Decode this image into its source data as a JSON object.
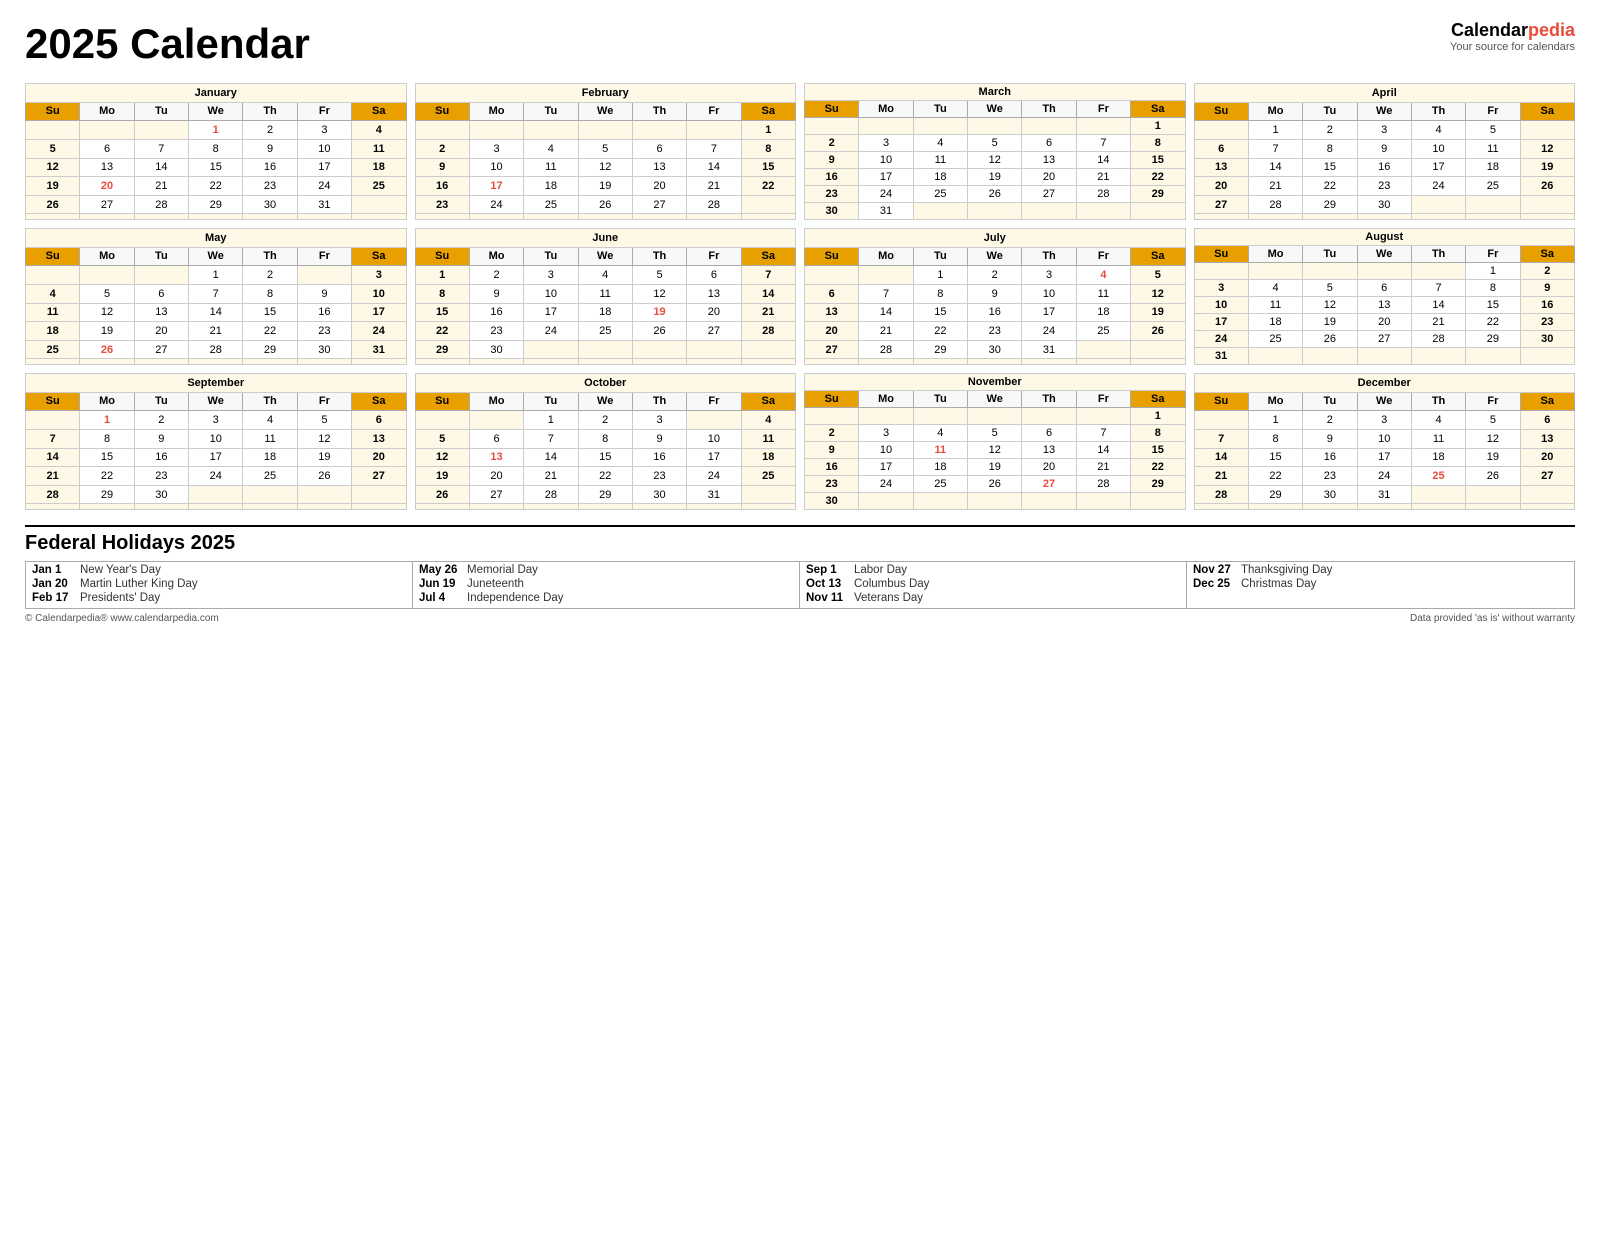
{
  "header": {
    "title": "2025 Calendar",
    "brand_name": "Calendar",
    "brand_em": "pedia",
    "brand_sub": "Your source for calendars"
  },
  "months": [
    {
      "name": "January",
      "days_of_week": [
        "Su",
        "Mo",
        "Tu",
        "We",
        "Th",
        "Fr",
        "Sa"
      ],
      "rows": [
        [
          "",
          "",
          "",
          "1",
          "2",
          "3",
          "4"
        ],
        [
          "5",
          "6",
          "7",
          "8",
          "9",
          "10",
          "11"
        ],
        [
          "12",
          "13",
          "14",
          "15",
          "16",
          "17",
          "18"
        ],
        [
          "19",
          "20",
          "21",
          "22",
          "23",
          "24",
          "25"
        ],
        [
          "26",
          "27",
          "28",
          "29",
          "30",
          "31",
          ""
        ],
        [
          "",
          "",
          "",
          "",
          "",
          "",
          ""
        ]
      ],
      "red": [
        "1",
        "20"
      ],
      "col1_bold": true,
      "col7_bold": true
    },
    {
      "name": "February",
      "days_of_week": [
        "Su",
        "Mo",
        "Tu",
        "We",
        "Th",
        "Fr",
        "Sa"
      ],
      "rows": [
        [
          "",
          "",
          "",
          "",
          "",
          "",
          "1"
        ],
        [
          "2",
          "3",
          "4",
          "5",
          "6",
          "7",
          "8"
        ],
        [
          "9",
          "10",
          "11",
          "12",
          "13",
          "14",
          "15"
        ],
        [
          "16",
          "17",
          "18",
          "19",
          "20",
          "21",
          "22"
        ],
        [
          "23",
          "24",
          "25",
          "26",
          "27",
          "28",
          ""
        ],
        [
          "",
          "",
          "",
          "",
          "",
          "",
          ""
        ]
      ],
      "red": [
        "17"
      ],
      "col1_bold": true,
      "col7_bold": true
    },
    {
      "name": "March",
      "days_of_week": [
        "Su",
        "Mo",
        "Tu",
        "We",
        "Th",
        "Fr",
        "Sa"
      ],
      "rows": [
        [
          "",
          "",
          "",
          "",
          "",
          "",
          "1"
        ],
        [
          "2",
          "3",
          "4",
          "5",
          "6",
          "7",
          "8"
        ],
        [
          "9",
          "10",
          "11",
          "12",
          "13",
          "14",
          "15"
        ],
        [
          "16",
          "17",
          "18",
          "19",
          "20",
          "21",
          "22"
        ],
        [
          "23",
          "24",
          "25",
          "26",
          "27",
          "28",
          "29"
        ],
        [
          "30",
          "31",
          "",
          "",
          "",
          "",
          ""
        ]
      ],
      "red": [],
      "col1_bold": true,
      "col7_bold": true
    },
    {
      "name": "April",
      "days_of_week": [
        "Su",
        "Mo",
        "Tu",
        "We",
        "Th",
        "Fr",
        "Sa"
      ],
      "rows": [
        [
          "",
          "1",
          "2",
          "3",
          "4",
          "5",
          ""
        ],
        [
          "6",
          "7",
          "8",
          "9",
          "10",
          "11",
          "12"
        ],
        [
          "13",
          "14",
          "15",
          "16",
          "17",
          "18",
          "19"
        ],
        [
          "20",
          "21",
          "22",
          "23",
          "24",
          "25",
          "26"
        ],
        [
          "27",
          "28",
          "29",
          "30",
          "",
          "",
          ""
        ],
        [
          "",
          "",
          "",
          "",
          "",
          "",
          ""
        ]
      ],
      "red": [],
      "col1_bold": true,
      "col7_bold": true
    },
    {
      "name": "May",
      "days_of_week": [
        "Su",
        "Mo",
        "Tu",
        "We",
        "Th",
        "Fr",
        "Sa"
      ],
      "rows": [
        [
          "",
          "",
          "",
          "1",
          "2",
          "",
          "3"
        ],
        [
          "4",
          "5",
          "6",
          "7",
          "8",
          "9",
          "10"
        ],
        [
          "11",
          "12",
          "13",
          "14",
          "15",
          "16",
          "17"
        ],
        [
          "18",
          "19",
          "20",
          "21",
          "22",
          "23",
          "24"
        ],
        [
          "25",
          "26",
          "27",
          "28",
          "29",
          "30",
          "31"
        ],
        [
          "",
          "",
          "",
          "",
          "",
          "",
          ""
        ]
      ],
      "red": [
        "26"
      ],
      "col1_bold": true,
      "col7_bold": true
    },
    {
      "name": "June",
      "days_of_week": [
        "Su",
        "Mo",
        "Tu",
        "We",
        "Th",
        "Fr",
        "Sa"
      ],
      "rows": [
        [
          "1",
          "2",
          "3",
          "4",
          "5",
          "6",
          "7"
        ],
        [
          "8",
          "9",
          "10",
          "11",
          "12",
          "13",
          "14"
        ],
        [
          "15",
          "16",
          "17",
          "18",
          "19",
          "20",
          "21"
        ],
        [
          "22",
          "23",
          "24",
          "25",
          "26",
          "27",
          "28"
        ],
        [
          "29",
          "30",
          "",
          "",
          "",
          "",
          ""
        ],
        [
          "",
          "",
          "",
          "",
          "",
          "",
          ""
        ]
      ],
      "red": [
        "19"
      ],
      "col1_bold": true,
      "col7_bold": true
    },
    {
      "name": "July",
      "days_of_week": [
        "Su",
        "Mo",
        "Tu",
        "We",
        "Th",
        "Fr",
        "Sa"
      ],
      "rows": [
        [
          "",
          "",
          "1",
          "2",
          "3",
          "4",
          "5"
        ],
        [
          "6",
          "7",
          "8",
          "9",
          "10",
          "11",
          "12"
        ],
        [
          "13",
          "14",
          "15",
          "16",
          "17",
          "18",
          "19"
        ],
        [
          "20",
          "21",
          "22",
          "23",
          "24",
          "25",
          "26"
        ],
        [
          "27",
          "28",
          "29",
          "30",
          "31",
          "",
          ""
        ],
        [
          "",
          "",
          "",
          "",
          "",
          "",
          ""
        ]
      ],
      "red": [
        "4"
      ],
      "col1_bold": true,
      "col7_bold": true
    },
    {
      "name": "August",
      "days_of_week": [
        "Su",
        "Mo",
        "Tu",
        "We",
        "Th",
        "Fr",
        "Sa"
      ],
      "rows": [
        [
          "",
          "",
          "",
          "",
          "",
          "1",
          "2"
        ],
        [
          "3",
          "4",
          "5",
          "6",
          "7",
          "8",
          "9"
        ],
        [
          "10",
          "11",
          "12",
          "13",
          "14",
          "15",
          "16"
        ],
        [
          "17",
          "18",
          "19",
          "20",
          "21",
          "22",
          "23"
        ],
        [
          "24",
          "25",
          "26",
          "27",
          "28",
          "29",
          "30"
        ],
        [
          "31",
          "",
          "",
          "",
          "",
          "",
          ""
        ]
      ],
      "red": [],
      "col1_bold": true,
      "col7_bold": true
    },
    {
      "name": "September",
      "days_of_week": [
        "Su",
        "Mo",
        "Tu",
        "We",
        "Th",
        "Fr",
        "Sa"
      ],
      "rows": [
        [
          "",
          "1",
          "2",
          "3",
          "4",
          "5",
          "6"
        ],
        [
          "7",
          "8",
          "9",
          "10",
          "11",
          "12",
          "13"
        ],
        [
          "14",
          "15",
          "16",
          "17",
          "18",
          "19",
          "20"
        ],
        [
          "21",
          "22",
          "23",
          "24",
          "25",
          "26",
          "27"
        ],
        [
          "28",
          "29",
          "30",
          "",
          "",
          "",
          ""
        ],
        [
          "",
          "",
          "",
          "",
          "",
          "",
          ""
        ]
      ],
      "red": [
        "1"
      ],
      "col1_bold": true,
      "col7_bold": true
    },
    {
      "name": "October",
      "days_of_week": [
        "Su",
        "Mo",
        "Tu",
        "We",
        "Th",
        "Fr",
        "Sa"
      ],
      "rows": [
        [
          "",
          "",
          "1",
          "2",
          "3",
          "",
          "4"
        ],
        [
          "5",
          "6",
          "7",
          "8",
          "9",
          "10",
          "11"
        ],
        [
          "12",
          "13",
          "14",
          "15",
          "16",
          "17",
          "18"
        ],
        [
          "19",
          "20",
          "21",
          "22",
          "23",
          "24",
          "25"
        ],
        [
          "26",
          "27",
          "28",
          "29",
          "30",
          "31",
          ""
        ],
        [
          "",
          "",
          "",
          "",
          "",
          "",
          ""
        ]
      ],
      "red": [
        "13"
      ],
      "col1_bold": true,
      "col7_bold": true
    },
    {
      "name": "November",
      "days_of_week": [
        "Su",
        "Mo",
        "Tu",
        "We",
        "Th",
        "Fr",
        "Sa"
      ],
      "rows": [
        [
          "",
          "",
          "",
          "",
          "",
          "",
          "1"
        ],
        [
          "2",
          "3",
          "4",
          "5",
          "6",
          "7",
          "8"
        ],
        [
          "9",
          "10",
          "11",
          "12",
          "13",
          "14",
          "15"
        ],
        [
          "16",
          "17",
          "18",
          "19",
          "20",
          "21",
          "22"
        ],
        [
          "23",
          "24",
          "25",
          "26",
          "27",
          "28",
          "29"
        ],
        [
          "30",
          "",
          "",
          "",
          "",
          "",
          ""
        ]
      ],
      "red": [
        "11",
        "27"
      ],
      "col1_bold": true,
      "col7_bold": true
    },
    {
      "name": "December",
      "days_of_week": [
        "Su",
        "Mo",
        "Tu",
        "We",
        "Th",
        "Fr",
        "Sa"
      ],
      "rows": [
        [
          "",
          "1",
          "2",
          "3",
          "4",
          "5",
          "6"
        ],
        [
          "7",
          "8",
          "9",
          "10",
          "11",
          "12",
          "13"
        ],
        [
          "14",
          "15",
          "16",
          "17",
          "18",
          "19",
          "20"
        ],
        [
          "21",
          "22",
          "23",
          "24",
          "25",
          "26",
          "27"
        ],
        [
          "28",
          "29",
          "30",
          "31",
          "",
          "",
          ""
        ],
        [
          "",
          "",
          "",
          "",
          "",
          "",
          ""
        ]
      ],
      "red": [
        "25"
      ],
      "col1_bold": true,
      "col7_bold": true
    }
  ],
  "holidays": {
    "title": "Federal Holidays 2025",
    "columns": [
      [
        {
          "date": "Jan 1",
          "name": "New Year's Day"
        },
        {
          "date": "Jan 20",
          "name": "Martin Luther King Day"
        },
        {
          "date": "Feb 17",
          "name": "Presidents' Day"
        }
      ],
      [
        {
          "date": "May 26",
          "name": "Memorial Day"
        },
        {
          "date": "Jun 19",
          "name": "Juneteenth"
        },
        {
          "date": "Jul 4",
          "name": "Independence Day"
        }
      ],
      [
        {
          "date": "Sep 1",
          "name": "Labor Day"
        },
        {
          "date": "Oct 13",
          "name": "Columbus Day"
        },
        {
          "date": "Nov 11",
          "name": "Veterans Day"
        }
      ],
      [
        {
          "date": "Nov 27",
          "name": "Thanksgiving Day"
        },
        {
          "date": "Dec 25",
          "name": "Christmas Day"
        },
        {
          "date": "",
          "name": ""
        }
      ]
    ]
  },
  "footer": {
    "copyright": "© Calendarpedia®  www.calendarpedia.com",
    "disclaimer": "Data provided 'as is' without warranty"
  }
}
